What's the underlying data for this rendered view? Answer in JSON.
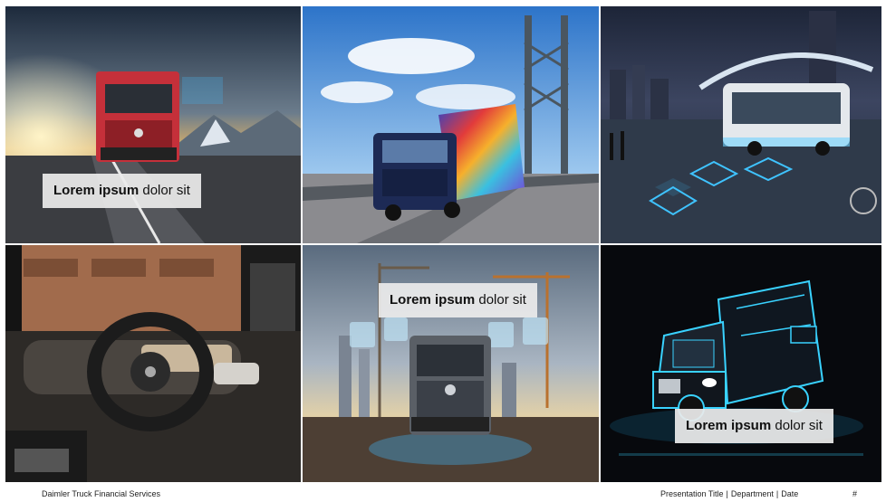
{
  "captions": [
    {
      "bold": "Lorem ipsum",
      "rest": " dolor sit"
    },
    {
      "bold": "Lorem ipsum",
      "rest": " dolor sit"
    },
    {
      "bold": "Lorem ipsum",
      "rest": " dolor sit"
    }
  ],
  "footer": {
    "company": "Daimler Truck Financial Services",
    "presentation_title": "Presentation Title",
    "department": "Department",
    "date": "Date",
    "separator": "|",
    "page_number": "#"
  },
  "images": [
    {
      "description": "Red Mercedes-Benz truck on road with mountains at sunset",
      "icon": "truck-photo"
    },
    {
      "description": "Colorfully painted truck on suspension bridge",
      "icon": "truck-photo"
    },
    {
      "description": "Electric bus in futuristic city at night",
      "icon": "bus-photo"
    },
    {
      "description": "Truck cabin interior with steering wheel",
      "icon": "cockpit-photo"
    },
    {
      "description": "Truck at construction site with digital overlay icons",
      "icon": "truck-photo"
    },
    {
      "description": "Electric box truck with neon outline on dark background",
      "icon": "truck-photo"
    }
  ]
}
